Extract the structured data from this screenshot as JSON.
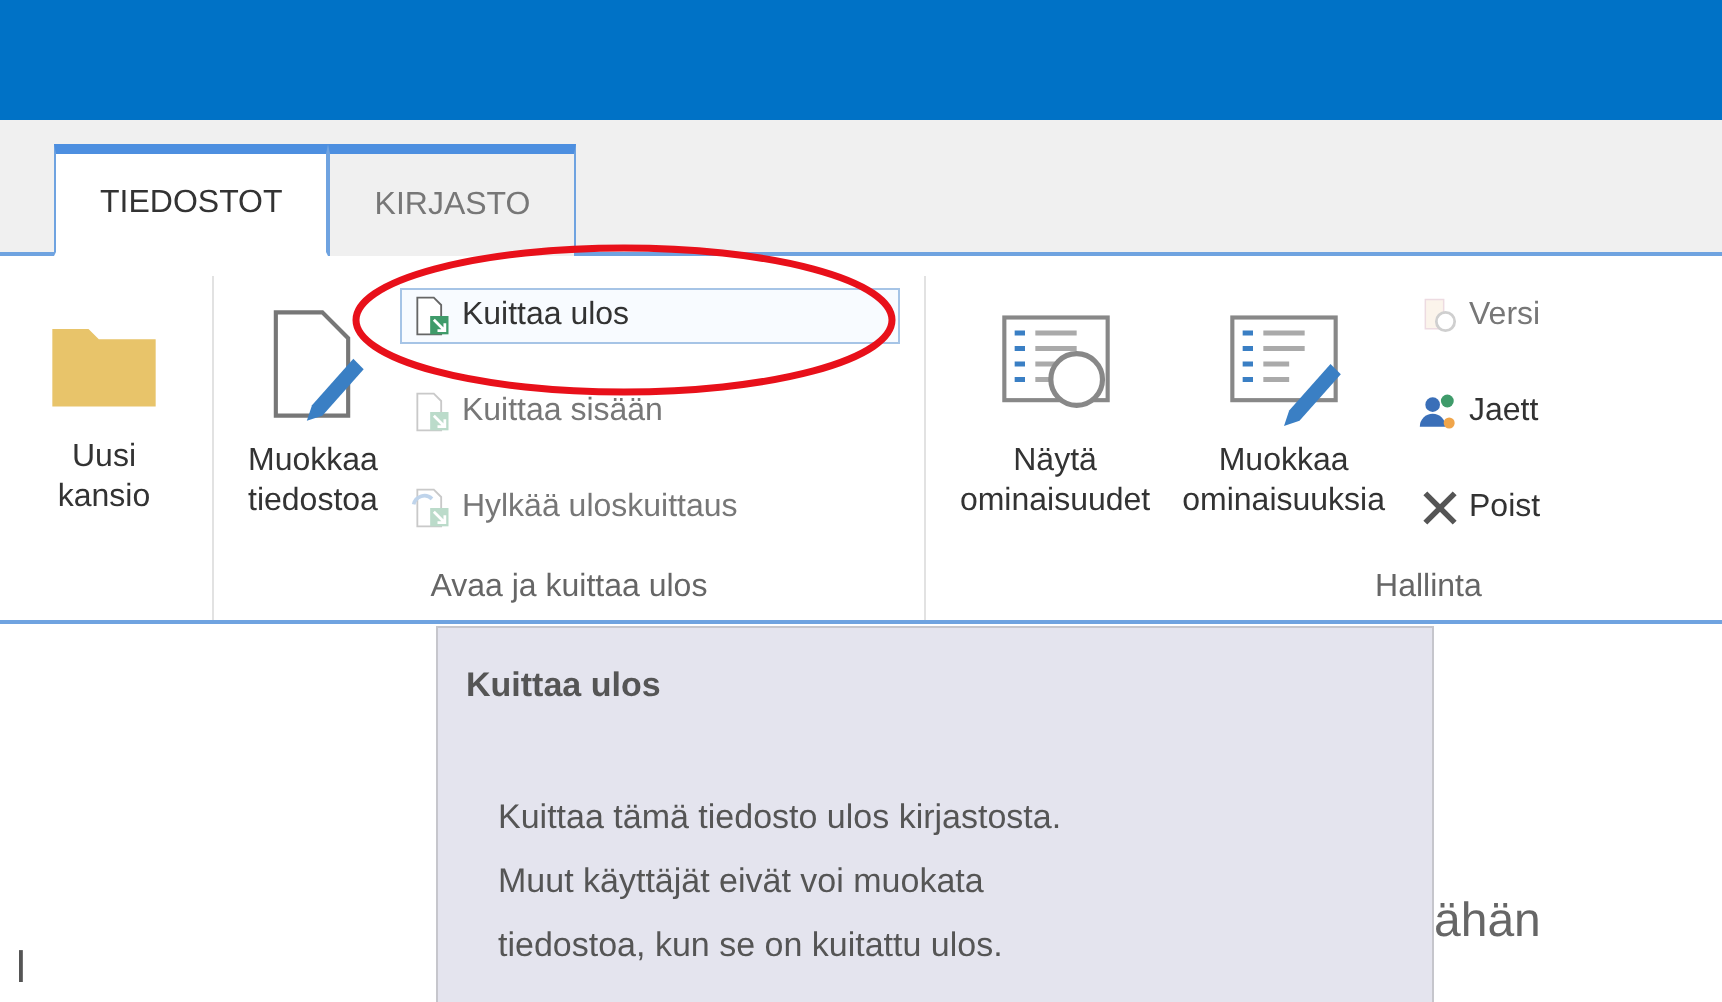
{
  "tabs": [
    {
      "label": "TIEDOSTOT",
      "selected": true
    },
    {
      "label": "KIRJASTO",
      "selected": false
    }
  ],
  "ribbon": {
    "groups": [
      {
        "buttons": [
          {
            "kind": "large",
            "label": "Uusi\nkansio",
            "disabled": false
          }
        ]
      },
      {
        "label": "Avaa ja kuittaa ulos",
        "buttons": [
          {
            "kind": "large",
            "label": "Muokkaa\ntiedostoa",
            "disabled": false
          },
          {
            "kind": "small",
            "label": "Kuittaa ulos",
            "disabled": false,
            "hovered": true
          },
          {
            "kind": "small",
            "label": "Kuittaa sisään",
            "disabled": true,
            "hovered": false
          },
          {
            "kind": "small",
            "label": "Hylkää uloskuittaus",
            "disabled": true,
            "hovered": false
          }
        ]
      },
      {
        "label": "Hallinta",
        "buttons": [
          {
            "kind": "large",
            "label": "Näytä\nominaisuudet",
            "disabled": false
          },
          {
            "kind": "large",
            "label": "Muokkaa\nominaisuuksia",
            "disabled": false
          },
          {
            "kind": "small",
            "label": "Versi",
            "disabled": true,
            "hovered": false
          },
          {
            "kind": "small",
            "label": "Jaett",
            "disabled": false,
            "hovered": false
          },
          {
            "kind": "small",
            "label": "Poist",
            "disabled": false,
            "hovered": false
          }
        ]
      }
    ]
  },
  "page_text": [
    "l",
    "ähän"
  ],
  "tooltip": {
    "title": "Kuittaa ulos",
    "text": "Kuittaa tämä tiedosto ulos kirjastosta.\nMuut käyttäjät eivät voi muokata\ntiedostoa, kun se on kuitattu ulos."
  }
}
